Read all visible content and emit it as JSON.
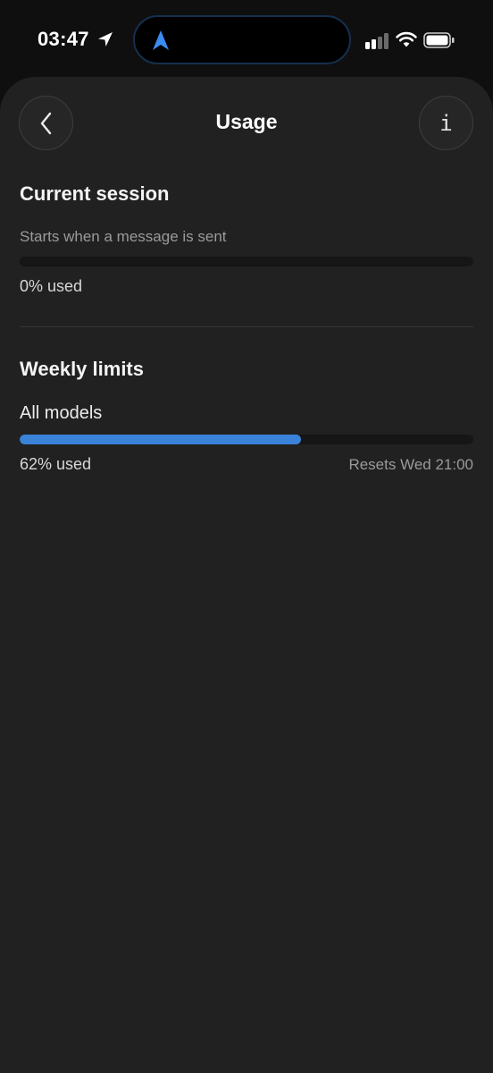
{
  "status_bar": {
    "time": "03:47",
    "icons": [
      "location-arrow-icon",
      "navigation-icon",
      "cellular-icon",
      "wifi-icon",
      "battery-icon"
    ]
  },
  "header": {
    "title": "Usage",
    "back_icon": "chevron-left-icon",
    "info_label": "i"
  },
  "current_session": {
    "heading": "Current session",
    "subtitle": "Starts when a message is sent",
    "progress": 0,
    "used_label": "0% used"
  },
  "weekly_limits": {
    "heading": "Weekly limits",
    "model_label": "All models",
    "progress": 0.62,
    "used_label": "62% used",
    "reset_label": "Resets Wed 21:00"
  },
  "colors": {
    "background": "#212121",
    "accent": "#3b82d9",
    "track": "#161616"
  }
}
